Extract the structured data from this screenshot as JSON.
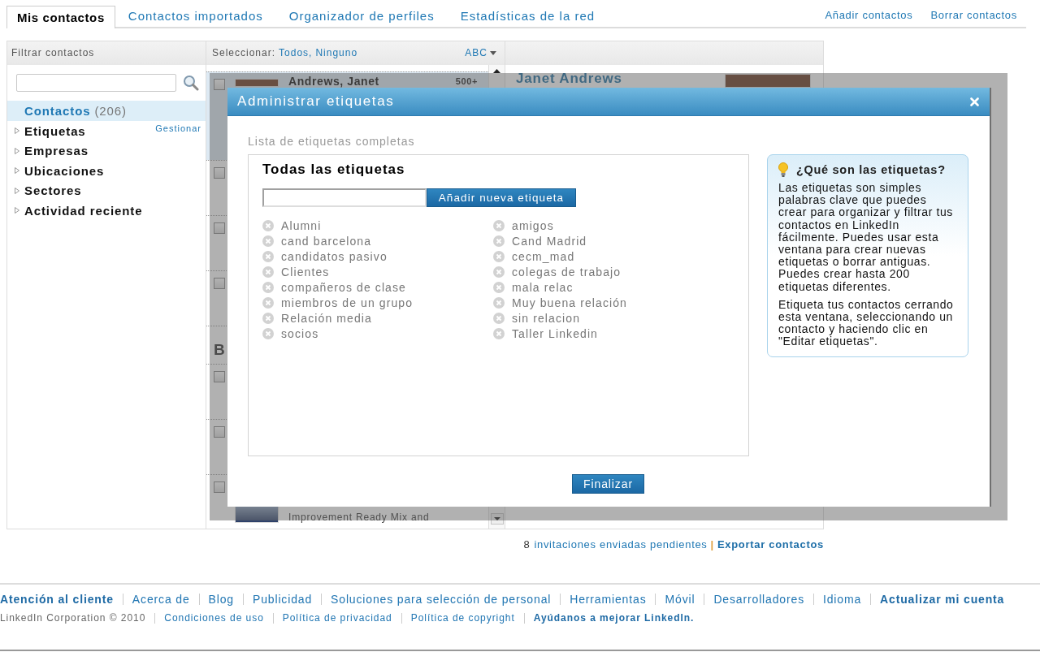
{
  "tabs": [
    {
      "label": "Mis contactos",
      "selected": true
    },
    {
      "label": "Contactos importados",
      "selected": false
    },
    {
      "label": "Organizador de perfiles",
      "selected": false
    },
    {
      "label": "Estadísticas de la red",
      "selected": false
    }
  ],
  "header_actions": [
    "Añadir contactos",
    "Borrar contactos"
  ],
  "filter_panel": {
    "title": "Filtrar contactos",
    "filters": [
      {
        "kind": "all",
        "label": "Contactos",
        "count": "(206)",
        "selected": true
      },
      {
        "kind": "group",
        "label": "Etiquetas",
        "action": "Gestionar",
        "selected": false,
        "expanded": false
      },
      {
        "kind": "group",
        "label": "Empresas",
        "selected": false,
        "expanded": false
      },
      {
        "kind": "group",
        "label": "Ubicaciones",
        "selected": false,
        "expanded": false
      },
      {
        "kind": "group",
        "label": "Sectores",
        "selected": false,
        "expanded": false
      },
      {
        "kind": "group",
        "label": "Actividad reciente",
        "selected": false,
        "expanded": false
      }
    ]
  },
  "contact_list": {
    "select_label": "Seleccionar:",
    "select_links": [
      "Todos,",
      "Ninguno"
    ],
    "sort": "ABC",
    "rows": [
      {
        "kind": "contact",
        "name": "Andrews, Janet",
        "connections": "500+",
        "selected": true,
        "checked": false
      },
      {
        "kind": "contact",
        "selected": false,
        "checked": false
      },
      {
        "kind": "contact",
        "selected": false,
        "checked": false
      },
      {
        "kind": "contact",
        "selected": false,
        "checked": false
      },
      {
        "kind": "letter",
        "label": "B"
      },
      {
        "kind": "contact",
        "selected": false,
        "checked": false
      },
      {
        "kind": "contact",
        "selected": false,
        "checked": false
      },
      {
        "kind": "contact",
        "headline": "Improvement Ready Mix and",
        "selected": false,
        "checked": false
      }
    ]
  },
  "contact_detail": {
    "name": "Janet Andrews"
  },
  "dialog": {
    "title": "Administrar etiquetas",
    "caption": "Lista de etiquetas completas",
    "box_title": "Todas las etiquetas",
    "add_button": "Añadir nueva etiqueta",
    "tags": [
      "Alumni",
      "cand barcelona",
      "candidatos pasivo",
      "Clientes",
      "compañeros de clase",
      "miembros de un grupo",
      "Relación media",
      "socios",
      "amigos",
      "Cand Madrid",
      "cecm_mad",
      "colegas de trabajo",
      "mala relac",
      "Muy buena relación",
      "sin relacion",
      "Taller Linkedin"
    ],
    "help": {
      "title": "¿Qué son las etiquetas?",
      "paragraphs": [
        "Las etiquetas son simples palabras clave que puedes crear para organizar y filtrar tus contactos en LinkedIn fácilmente. Puedes usar esta ventana para crear nuevas etiquetas o borrar antiguas. Puedes crear hasta 200 etiquetas diferentes.",
        "Etiqueta tus contactos cerrando esta ventana, seleccionando un contacto y haciendo clic en \"Editar etiquetas\"."
      ]
    },
    "done_button": "Finalizar"
  },
  "invitations": {
    "count": "8",
    "link": "invitaciones enviadas pendientes",
    "separator": "|",
    "export_link": "Exportar contactos"
  },
  "footer": {
    "links": [
      {
        "label": "Atención al cliente",
        "kind": "featured"
      },
      {
        "label": "Acerca de",
        "kind": "link"
      },
      {
        "label": "Blog",
        "kind": "link"
      },
      {
        "label": "Publicidad",
        "kind": "link"
      },
      {
        "label": "Soluciones para selección de personal",
        "kind": "link"
      },
      {
        "label": "Herramientas",
        "kind": "link"
      },
      {
        "label": "Móvil",
        "kind": "link"
      },
      {
        "label": "Desarrolladores",
        "kind": "link"
      },
      {
        "label": "Idioma",
        "kind": "link"
      },
      {
        "label": "Actualizar mi cuenta",
        "kind": "featured"
      }
    ],
    "legal": [
      {
        "label": "LinkedIn Corporation © 2010",
        "kind": "text"
      },
      {
        "label": "Condiciones de uso",
        "kind": "link"
      },
      {
        "label": "Política de privacidad",
        "kind": "link"
      },
      {
        "label": "Política de copyright",
        "kind": "link"
      },
      {
        "label": "Ayúdanos a mejorar LinkedIn.",
        "kind": "featured"
      }
    ]
  }
}
